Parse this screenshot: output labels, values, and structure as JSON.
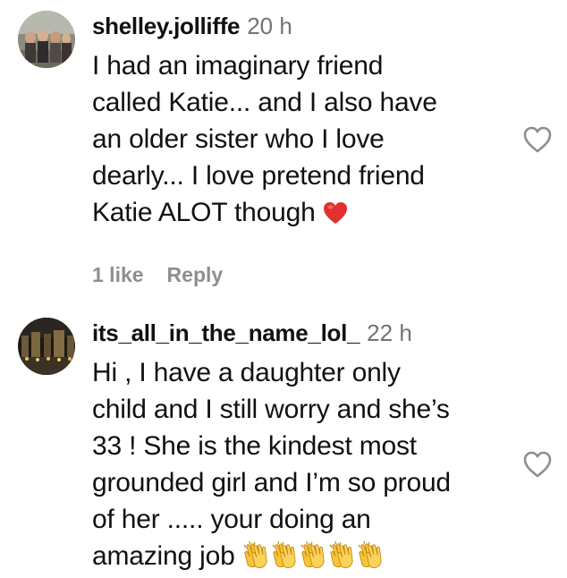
{
  "comments": [
    {
      "username": "shelley.jolliffe",
      "time": "20 h",
      "lines": [
        "I had an imaginary friend",
        "called Katie... and I also have",
        "an older sister who I love",
        "dearly... I love pretend friend",
        "Katie ALOT though"
      ],
      "emoji": "red-heart",
      "likes_label": "1 like",
      "reply_label": "Reply",
      "avatar": "group-photo-avatar"
    },
    {
      "username": "its_all_in_the_name_lol_",
      "time": "22 h",
      "lines": [
        "Hi , I have a daughter only",
        "child and I still worry and she’s",
        "33 ! She is the kindest most",
        "grounded girl and I’m so proud",
        "of her ..... your doing an",
        "amazing job"
      ],
      "emoji": "clapping-hands x5",
      "avatar": "night-city-avatar"
    }
  ],
  "colors": {
    "text": "#111111",
    "muted": "#737373",
    "action": "#8e8e8e",
    "heart_emoji": "#e0302f",
    "clap_emoji": "#f7c437"
  }
}
